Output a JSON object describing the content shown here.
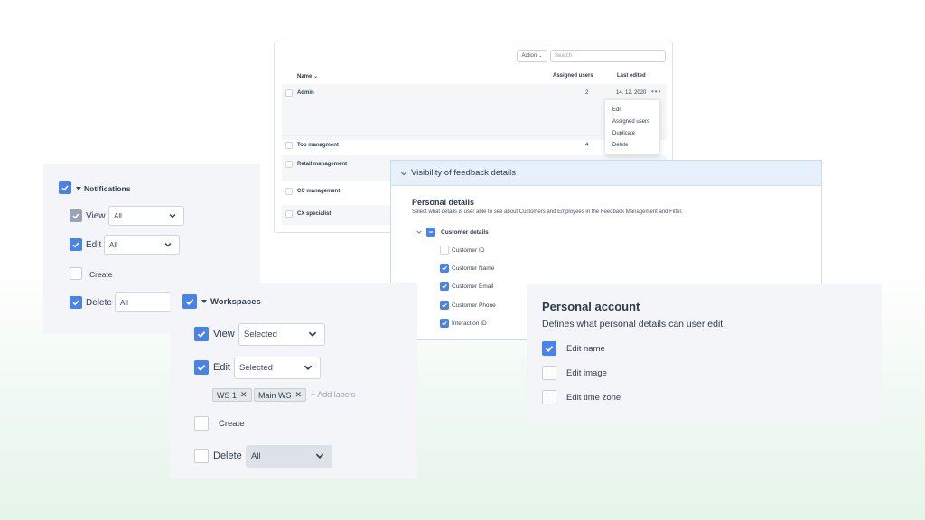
{
  "table": {
    "action_label": "Action",
    "search_placeholder": "Search",
    "columns": {
      "name": "Name",
      "assigned": "Assigned users",
      "edited": "Last edited"
    },
    "rows": [
      {
        "name": "Admin",
        "count": "2",
        "date": "14. 12. 2020"
      },
      {
        "name": "Top managment",
        "count": "4",
        "date": ""
      },
      {
        "name": "Retail management",
        "count": "",
        "date": ""
      },
      {
        "name": "CC management",
        "count": "",
        "date": ""
      },
      {
        "name": "CX specialist",
        "count": "",
        "date": ""
      }
    ],
    "menu": [
      "Edit",
      "Assigned users",
      "Duplicate",
      "Delete"
    ]
  },
  "notifications": {
    "title": "Notifications",
    "view_label": "View",
    "view_value": "All",
    "edit_label": "Edit",
    "edit_value": "All",
    "create_label": "Create",
    "delete_label": "Delete",
    "delete_value": "All"
  },
  "workspaces": {
    "title": "Workspaces",
    "view_label": "View",
    "view_value": "Selected",
    "edit_label": "Edit",
    "edit_value": "Selected",
    "tags": [
      "WS 1",
      "Main WS"
    ],
    "add_labels": "+ Add labels",
    "create_label": "Create",
    "delete_label": "Delete",
    "delete_value": "All"
  },
  "visibility": {
    "header": "Visibility of feedback details",
    "section_title": "Personal details",
    "section_desc": "Select what details is user able to see about Customers and Employees in the Feedback Management and Filter.",
    "group": "Customer details",
    "items": [
      {
        "label": "Customer ID",
        "checked": false
      },
      {
        "label": "Customer Name",
        "checked": true
      },
      {
        "label": "Customer Email",
        "checked": true
      },
      {
        "label": "Customer Phone",
        "checked": true
      },
      {
        "label": "Interaction ID",
        "checked": true
      }
    ]
  },
  "account": {
    "title": "Personal account",
    "desc": "Defines what personal details can user edit.",
    "items": [
      {
        "label": "Edit name",
        "checked": true
      },
      {
        "label": "Edit image",
        "checked": false
      },
      {
        "label": "Edit time zone",
        "checked": false
      }
    ]
  },
  "colors": {
    "accent": "#4a82e8",
    "panel": "#f3f5f8",
    "header": "#e6f1fb"
  }
}
